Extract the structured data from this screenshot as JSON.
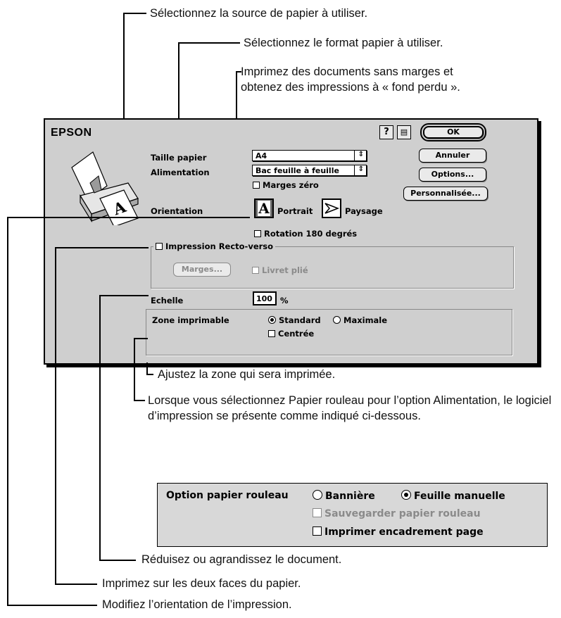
{
  "annotations": {
    "paper_source": "Sélectionnez la source de papier à utiliser.",
    "paper_size": "Sélectionnez le format papier à utiliser.",
    "borderless_line1": "Imprimez des documents sans marges et",
    "borderless_line2": "obtenez des impressions à « fond perdu ».",
    "printable_area": "Ajustez la zone qui sera imprimée.",
    "roll_paper_note": "Lorsque vous sélectionnez Papier rouleau pour l’option Alimentation, le logiciel d’impression se présente comme indiqué ci-dessous.",
    "scale": "Réduisez ou agrandissez le document.",
    "duplex": "Imprimez sur les deux faces du papier.",
    "orientation": "Modifiez l’orientation de l’impression."
  },
  "dialog": {
    "brand": "EPSON",
    "help_icon": "question-mark-icon",
    "help_label": "?",
    "paper_size_label": "Taille papier",
    "paper_size_value": "A4",
    "source_label": "Alimentation",
    "source_value": "Bac feuille à feuille",
    "borderless_label": "Marges zéro",
    "orientation_label": "Orientation",
    "portrait_label": "Portrait",
    "landscape_label": "Paysage",
    "rotate_label": "Rotation 180 degrés",
    "duplex_label": "Impression Recto-verso",
    "margins_button": "Marges...",
    "booklet_label": "Livret plié",
    "scale_label": "Echelle",
    "scale_value": "100",
    "scale_unit": "%",
    "printable_area_label": "Zone imprimable",
    "standard_label": "Standard",
    "maximum_label": "Maximale",
    "centered_label": "Centrée",
    "buttons": {
      "ok": "OK",
      "cancel": "Annuler",
      "options": "Options...",
      "custom": "Personnalisée..."
    },
    "state": {
      "borderless": false,
      "rotate180": false,
      "duplex": false,
      "booklet": false,
      "area": "Standard",
      "centered": false
    }
  },
  "roll_paper": {
    "label": "Option papier rouleau",
    "banner_label": "Bannière",
    "cut_sheet_label": "Feuille manuelle",
    "save_roll_label": "Sauvegarder papier rouleau",
    "print_frame_label": "Imprimer encadrement page",
    "selected": "Feuille manuelle"
  }
}
